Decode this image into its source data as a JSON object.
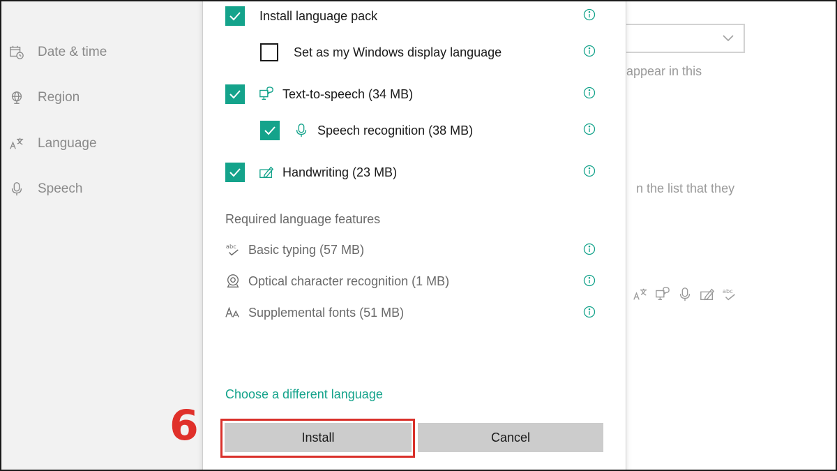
{
  "background": {
    "sidebar_items": [
      {
        "label": "Date & time",
        "icon": "calendar-clock-icon"
      },
      {
        "label": "Region",
        "icon": "globe-icon"
      },
      {
        "label": "Language",
        "icon": "language-icon"
      },
      {
        "label": "Speech",
        "icon": "microphone-icon"
      }
    ],
    "text_fragment_1": "appear in this",
    "text_fragment_2": "n the list that they"
  },
  "dialog": {
    "options": [
      {
        "label": "Install language pack",
        "checked": true,
        "icon": ""
      },
      {
        "label": "Set as my Windows display language",
        "checked": false,
        "icon": ""
      },
      {
        "label": "Text-to-speech (34 MB)",
        "checked": true,
        "icon": "text-to-speech-icon"
      },
      {
        "label": "Speech recognition (38 MB)",
        "checked": true,
        "icon": "microphone-icon"
      },
      {
        "label": "Handwriting (23 MB)",
        "checked": true,
        "icon": "handwriting-icon"
      }
    ],
    "required_title": "Required language features",
    "required_features": [
      {
        "label": "Basic typing (57 MB)",
        "icon": "basic-typing-icon"
      },
      {
        "label": "Optical character recognition (1 MB)",
        "icon": "ocr-icon"
      },
      {
        "label": "Supplemental fonts (51 MB)",
        "icon": "fonts-icon"
      }
    ],
    "choose_link": "Choose a different language",
    "install_label": "Install",
    "cancel_label": "Cancel"
  },
  "annotation": {
    "step_number": "6",
    "highlight_color": "#d9302a"
  },
  "colors": {
    "accent": "#14a38b",
    "button_gray": "#cccccc",
    "sidebar_bg": "#f2f2f2"
  }
}
